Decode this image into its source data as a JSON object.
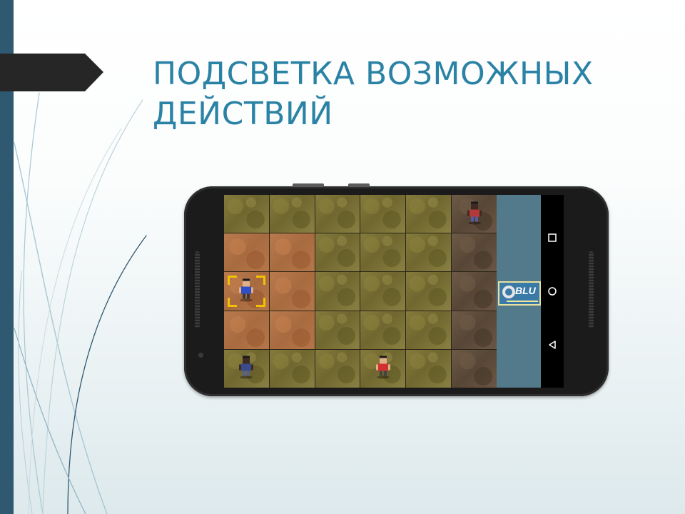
{
  "slide": {
    "title": "ПОДСВЕТКА ВОЗМОЖНЫХ ДЕЙСТВИЙ"
  },
  "colors": {
    "title": "#2a82a5",
    "left_bar": "#2f5871",
    "arrow": "#262626",
    "side_panel": "#527a8a",
    "selection": "#f2c200"
  },
  "game": {
    "board": [
      [
        "grass",
        "grass",
        "grass",
        "grass",
        "grass",
        "rock"
      ],
      [
        "dirt",
        "dirt",
        "grass",
        "grass",
        "grass",
        "rock"
      ],
      [
        "dirt",
        "dirt",
        "grass",
        "grass",
        "grass",
        "rock"
      ],
      [
        "dirt",
        "dirt",
        "grass",
        "grass",
        "grass",
        "rock"
      ],
      [
        "grass",
        "grass",
        "grass",
        "grass",
        "grass",
        "rock"
      ]
    ],
    "highlighted_tiles": "dirt",
    "selected_cell": [
      2,
      0
    ],
    "units": [
      {
        "row": 0,
        "col": 5,
        "name": "enemy-heavy-unit",
        "shirt": "#b23a3a",
        "pants": "#5a5aa0",
        "skin": "#3e2a20"
      },
      {
        "row": 2,
        "col": 0,
        "name": "player-blue-unit",
        "shirt": "#2f4fc8",
        "pants": "#3a3a3a",
        "skin": "#e0b088"
      },
      {
        "row": 4,
        "col": 0,
        "name": "player-heavy-unit",
        "shirt": "#3a4a8a",
        "pants": "#555f90",
        "skin": "#3e2a20"
      },
      {
        "row": 4,
        "col": 3,
        "name": "enemy-red-unit",
        "shirt": "#d03030",
        "pants": "#444444",
        "skin": "#e0b088"
      }
    ],
    "team_logo": {
      "text": "BLU",
      "icon": "blu-team-logo"
    }
  },
  "nav_bar": {
    "buttons": [
      {
        "name": "recents-button",
        "icon": "square-icon"
      },
      {
        "name": "home-button",
        "icon": "circle-icon"
      },
      {
        "name": "back-button",
        "icon": "triangle-back-icon"
      }
    ]
  }
}
